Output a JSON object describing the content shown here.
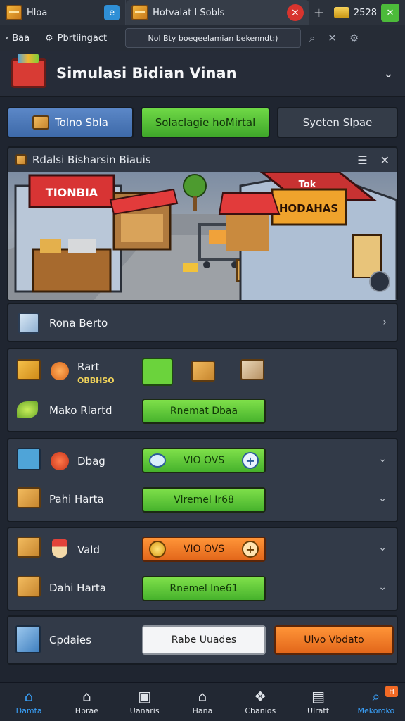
{
  "browser": {
    "tab1_title": "Hloa",
    "tab2_title": "Hotvalat I Sobls",
    "tab3_value": "2528",
    "back_label": "Baa",
    "site_label": "Pbrtiingact",
    "url": "Nol Bty boegeelamian bekenndt:)"
  },
  "app": {
    "title": "Simulasi Bidian Vinan"
  },
  "tabs": [
    {
      "label": "Tolno Sbla"
    },
    {
      "label": "Solaclagie hoMirtal"
    },
    {
      "label": "Syeten Slpae"
    }
  ],
  "scene": {
    "title": "Rdalsi Bisharsin Biauis",
    "sign_left": "TIONBIA",
    "sign_right": "HODAHAS",
    "sign_top": "Tok"
  },
  "list_row": {
    "label": "Rona Berto"
  },
  "panel1": {
    "row1_label": "Rart",
    "row1_sub": "OBBHSO",
    "row2_label": "Mako Rlartd",
    "row2_button": "Rnemat Dbaa"
  },
  "panel2": {
    "row1_label": "Dbag",
    "row1_button": "VIO OVS",
    "row2_label": "Pahi Harta",
    "row2_button": "Vlremel Ir68"
  },
  "panel3": {
    "row1_label": "Vald",
    "row1_button": "VIO OVS",
    "row2_label": "Dahi Harta",
    "row2_button": "Rnemel Ine61"
  },
  "updates": {
    "label": "Cpdaies",
    "button_white": "Rabe Uuades",
    "button_orange": "Ulvo Vbdato"
  },
  "bottom_nav": [
    {
      "label": "Damta",
      "icon": "home-icon"
    },
    {
      "label": "Hbrae",
      "icon": "house-icon"
    },
    {
      "label": "Uanaris",
      "icon": "save-icon"
    },
    {
      "label": "Hana",
      "icon": "barn-icon"
    },
    {
      "label": "Cbanios",
      "icon": "group-icon"
    },
    {
      "label": "Ulratt",
      "icon": "tablet-icon"
    },
    {
      "label": "Mekoroko",
      "icon": "search-icon",
      "badge": "H"
    }
  ],
  "colors": {
    "accent_green": "#46b22c",
    "accent_orange": "#e2661a",
    "accent_blue": "#3e6aa9",
    "nav_active": "#3aa4ff"
  }
}
